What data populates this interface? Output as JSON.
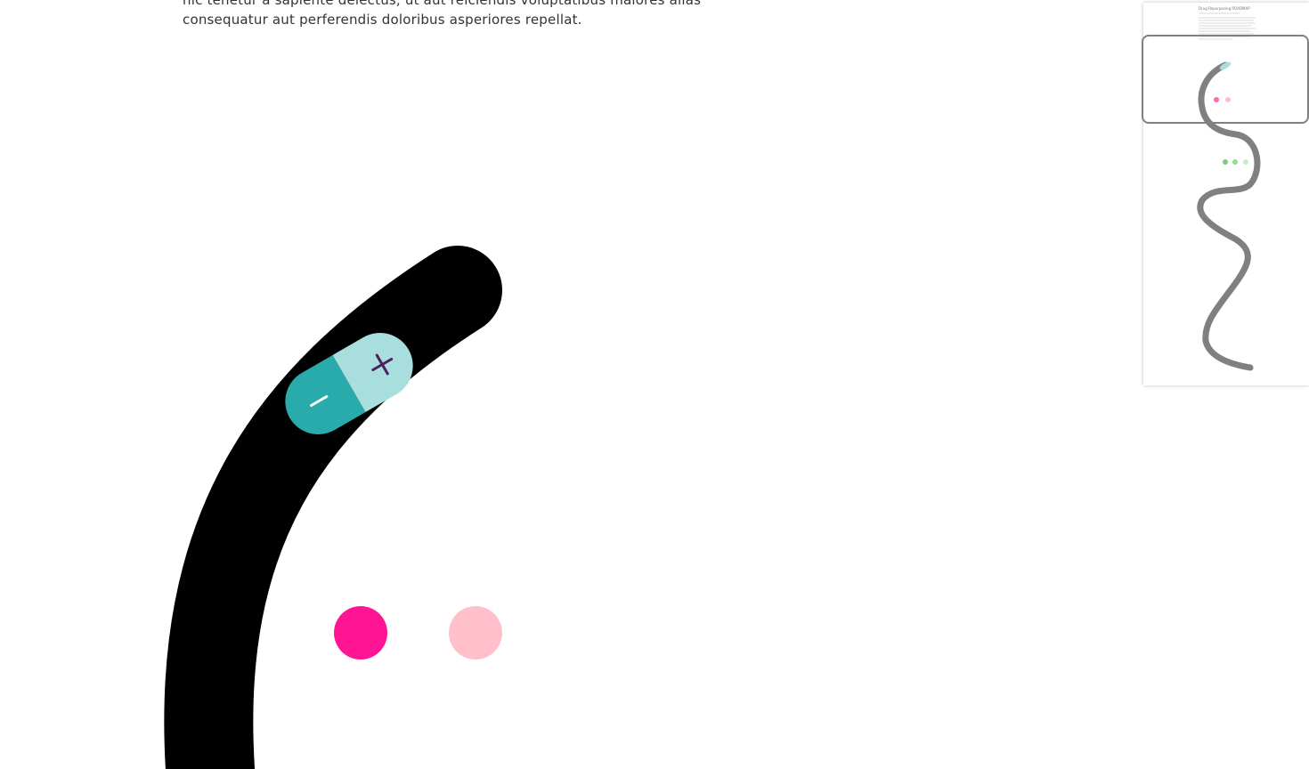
{
  "intro": {
    "line1": "hic tenetur a sapiente delectus, ut aut reiciendis voluptatibus maiores alias",
    "line2": "consequatur aut perferendis doloribus asperiores repellat."
  },
  "pill": {
    "minus_symbol": "−",
    "plus_symbol": "+"
  },
  "colors": {
    "path": "#000000",
    "pill_left": "#2aabab",
    "pill_right": "#a8dede",
    "plus": "#4a2060",
    "dot_pink_strong": "#ff1493",
    "dot_pink_light": "#ffc0cb",
    "minimap_path": "#808080",
    "minimap_green": "#7fc97f"
  },
  "minimap": {
    "title": "Drug Repurposing ROADMAP"
  }
}
